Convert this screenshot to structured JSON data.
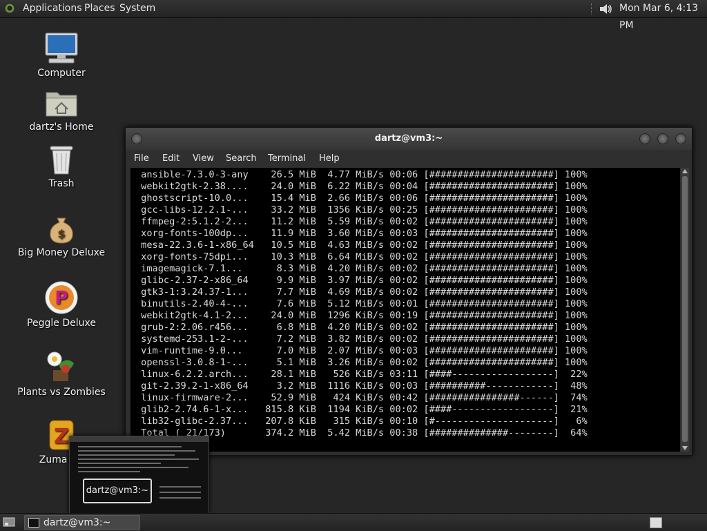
{
  "top_panel": {
    "menus": [
      "Applications",
      "Places",
      "System"
    ],
    "clock": "Mon Mar  6,  4:13 PM",
    "volume_icon": "speaker-icon"
  },
  "desktop": {
    "icons": [
      {
        "label": "Computer",
        "icon": "computer-icon"
      },
      {
        "label": "dartz's Home",
        "icon": "home-folder-icon"
      },
      {
        "label": "Trash",
        "icon": "trash-icon"
      },
      {
        "label": "Big Money Deluxe",
        "icon": "money-bag-icon"
      },
      {
        "label": "Peggle Deluxe",
        "icon": "peggle-icon"
      },
      {
        "label": "Plants vs Zombies",
        "icon": "plant-icon"
      },
      {
        "label": "Zuma De",
        "icon": "zuma-icon"
      }
    ]
  },
  "terminal": {
    "title": "dartz@vm3:~",
    "menu": [
      "File",
      "Edit",
      "View",
      "Search",
      "Terminal",
      "Help"
    ],
    "lines": [
      " ansible-7.3.0-3-any    26.5 MiB  4.77 MiB/s 00:06 [######################] 100%",
      " webkit2gtk-2.38....    24.0 MiB  6.22 MiB/s 00:04 [######################] 100%",
      " ghostscript-10.0...    15.4 MiB  2.66 MiB/s 00:06 [######################] 100%",
      " gcc-libs-12.2.1-...    33.2 MiB  1356 KiB/s 00:25 [######################] 100%",
      " ffmpeg-2:5.1.2-2...    11.2 MiB  5.59 MiB/s 00:02 [######################] 100%",
      " xorg-fonts-100dp...    11.9 MiB  3.60 MiB/s 00:03 [######################] 100%",
      " mesa-22.3.6-1-x86_64   10.5 MiB  4.63 MiB/s 00:02 [######################] 100%",
      " xorg-fonts-75dpi...    10.3 MiB  6.64 MiB/s 00:02 [######################] 100%",
      " imagemagick-7.1...      8.3 MiB  4.20 MiB/s 00:02 [######################] 100%",
      " glibc-2.37-2-x86_64     9.9 MiB  3.97 MiB/s 00:02 [######################] 100%",
      " gtk3-1:3.24.37-1...     7.7 MiB  4.69 MiB/s 00:02 [######################] 100%",
      " binutils-2.40-4-...     7.6 MiB  5.12 MiB/s 00:01 [######################] 100%",
      " webkit2gtk-4.1-2...    24.0 MiB  1296 KiB/s 00:19 [######################] 100%",
      " grub-2:2.06.r456...     6.8 MiB  4.20 MiB/s 00:02 [######################] 100%",
      " systemd-253.1-2-...     7.2 MiB  3.82 MiB/s 00:02 [######################] 100%",
      " vim-runtime-9.0...      7.0 MiB  2.07 MiB/s 00:03 [######################] 100%",
      " openssl-3.0.8-1-...     5.1 MiB  3.26 MiB/s 00:02 [######################] 100%",
      " linux-6.2.2.arch...    28.1 MiB   526 KiB/s 03:11 [####------------------]  22%",
      " git-2.39.2-1-x86_64     3.2 MiB  1116 KiB/s 00:03 [##########------------]  48%",
      " linux-firmware-2...    52.9 MiB   424 KiB/s 00:42 [################------]  74%",
      " glib2-2.74.6-1-x...   815.8 KiB  1194 KiB/s 00:02 [####------------------]  21%",
      " lib32-glibc-2.37...   207.8 KiB   315 KiB/s 00:10 [#---------------------]   6%",
      " Total ( 21/173)       374.2 MiB  5.42 MiB/s 00:38 [##############--------]  64%"
    ]
  },
  "preview": {
    "label": "dartz@vm3:~"
  },
  "bottom_panel": {
    "task_label": "dartz@vm3:~",
    "show_desktop_icon": "show-desktop-icon",
    "workspace_icon": "workspace-switcher-icon"
  }
}
